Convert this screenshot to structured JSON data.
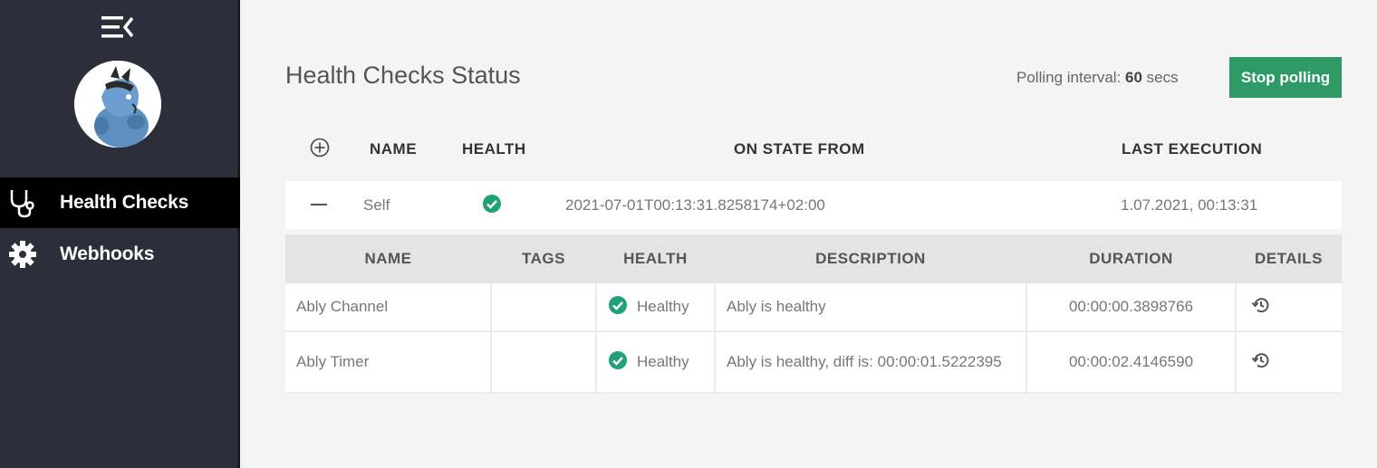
{
  "sidebar": {
    "items": [
      {
        "label": "Health Checks",
        "icon": "stethoscope-icon"
      },
      {
        "label": "Webhooks",
        "icon": "gear-icon"
      }
    ]
  },
  "main": {
    "title": "Health Checks Status",
    "polling_label": "Polling interval:",
    "polling_value": "60",
    "polling_unit": "secs",
    "stop_button": "Stop polling"
  },
  "checks_table": {
    "headers": [
      "NAME",
      "HEALTH",
      "ON STATE FROM",
      "LAST EXECUTION"
    ],
    "rows": [
      {
        "name": "Self",
        "on_state_from": "2021-07-01T00:13:31.8258174+02:00",
        "last_execution": "1.07.2021, 00:13:31"
      }
    ]
  },
  "entries_table": {
    "headers": [
      "NAME",
      "TAGS",
      "HEALTH",
      "DESCRIPTION",
      "DURATION",
      "DETAILS"
    ],
    "rows": [
      {
        "name": "Ably Channel",
        "tags": "",
        "health": "Healthy",
        "description": "Ably is healthy",
        "duration": "00:00:00.3898766"
      },
      {
        "name": "Ably Timer",
        "tags": "",
        "health": "Healthy",
        "description": "Ably is healthy, diff is: 00:00:01.5222395",
        "duration": "00:00:02.4146590"
      }
    ]
  },
  "colors": {
    "sidebar_bg": "#2c2f3a",
    "active_item_bg": "#000000",
    "accent_green": "#2e9b67",
    "healthy_green": "#22a07a"
  }
}
